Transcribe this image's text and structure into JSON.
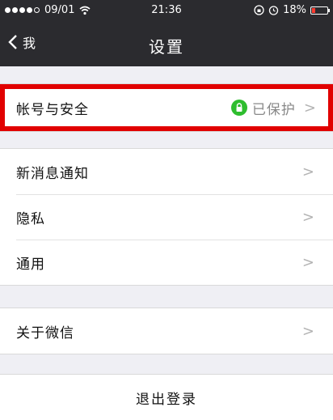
{
  "status_bar": {
    "date": "09/01",
    "time": "21:36",
    "battery": "18%",
    "wifi_icon": "wifi-icon"
  },
  "nav": {
    "back_label": "我",
    "title": "设置"
  },
  "account": {
    "label": "帐号与安全",
    "status": "已保护"
  },
  "group2": [
    {
      "label": "新消息通知"
    },
    {
      "label": "隐私"
    },
    {
      "label": "通用"
    }
  ],
  "about": {
    "label": "关于微信"
  },
  "logout_label": "退出登录",
  "colors": {
    "nav_bg": "#2b2b2f",
    "page_bg": "#efeff4",
    "highlight": "#e10000",
    "protect_green": "#2ebd2e"
  }
}
